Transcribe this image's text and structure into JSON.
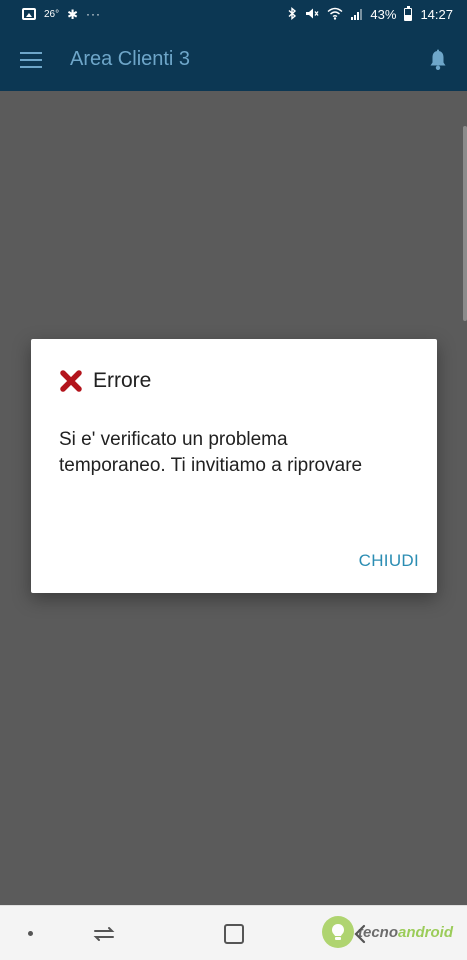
{
  "status_bar": {
    "temperature": "26°",
    "more": "···",
    "battery_percent": "43%",
    "time": "14:27",
    "icons": [
      "image-icon",
      "gear-icon",
      "bluetooth-icon",
      "mute-icon",
      "wifi-icon",
      "signal-icon",
      "battery-icon"
    ]
  },
  "app_bar": {
    "title": "Area Clienti 3",
    "menu_icon": "menu-icon",
    "notification_icon": "bell-icon",
    "color": "#0c3753",
    "title_color": "#6ea6c9"
  },
  "dialog": {
    "title": "Errore",
    "icon": "error-x-icon",
    "icon_color": "#b3141c",
    "message": "Si e' verificato un problema temporaneo. Ti invitiamo a riprovare",
    "button_label": "CHIUDI",
    "button_color": "#2b8db3"
  },
  "nav_bar": {
    "icons": [
      "dot-icon",
      "recent-apps-icon",
      "home-icon",
      "back-icon"
    ]
  },
  "watermark": {
    "part1": "tecno",
    "part2": "android"
  }
}
